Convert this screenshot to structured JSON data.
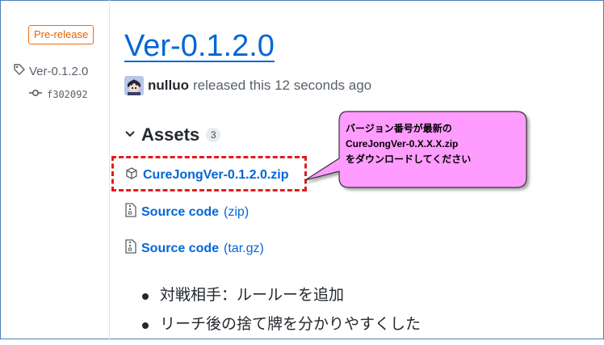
{
  "sidebar": {
    "badge": "Pre-release",
    "tag": "Ver-0.1.2.0",
    "commit": "f302092"
  },
  "release": {
    "title": "Ver-0.1.2.0",
    "author": "nulluo",
    "meta": "released this 12 seconds ago"
  },
  "assets": {
    "heading": "Assets",
    "count": "3",
    "items": [
      {
        "name": "CureJongVer-0.1.2.0.zip",
        "ext": ""
      },
      {
        "name": "Source code",
        "ext": "(zip)"
      },
      {
        "name": "Source code",
        "ext": "(tar.gz)"
      }
    ]
  },
  "callout": {
    "line1": "バージョン番号が最新の",
    "line2": "CureJongVer-0.X.X.X.zip",
    "line3": "をダウンロードしてください"
  },
  "notes": [
    "対戦相手：ルールーを追加",
    "リーチ後の捨て牌を分かりやすくした"
  ],
  "colors": {
    "link": "#0366d6",
    "badge": "#e36209",
    "highlight_border": "#e31c1c",
    "callout_fill": "#ff9cff"
  }
}
